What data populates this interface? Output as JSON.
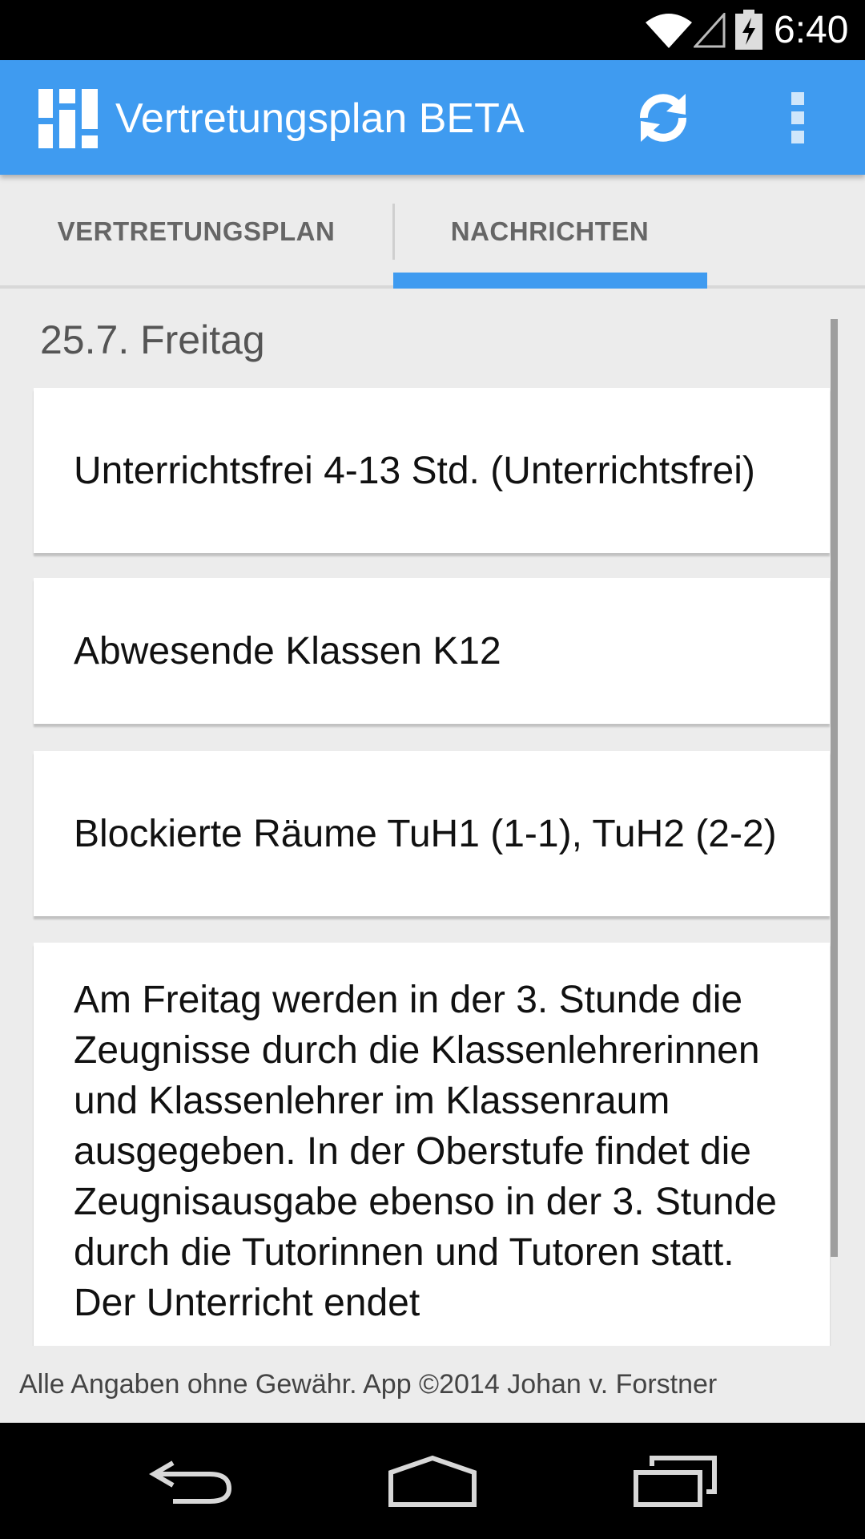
{
  "status_bar": {
    "time": "6:40",
    "icons": [
      "wifi-icon",
      "signal-icon",
      "battery-charging-icon"
    ]
  },
  "app_bar": {
    "title": "Vertretungsplan BETA",
    "icons": [
      "app-logo-icon",
      "refresh-icon",
      "overflow-menu-icon"
    ],
    "accent_color": "#3f9bf0"
  },
  "tabs": [
    {
      "label": "VERTRETUNGSPLAN",
      "selected": false
    },
    {
      "label": "NACHRICHTEN",
      "selected": true
    }
  ],
  "content": {
    "day_header": "25.7. Freitag",
    "cards": [
      {
        "text": "Unterrichtsfrei  4-13 Std. (Unterrichtsfrei)"
      },
      {
        "text": "Abwesende Klassen  K12"
      },
      {
        "text": "Blockierte Räume  TuH1 (1-1), TuH2 (2-2)"
      },
      {
        "text": "Am Freitag werden in der 3. Stunde die Zeugnisse durch die Klassenlehrerinnen und Klassenlehrer im Klassenraum ausgegeben. In der Oberstufe findet die Zeugnisausgabe ebenso in der 3. Stunde durch die Tutorinnen und Tutoren statt. Der Unterricht endet"
      }
    ]
  },
  "footer": {
    "text": "Alle Angaben ohne Gewähr. App ©2014 Johan v. Forstner"
  },
  "nav_bar": {
    "icons": [
      "back-icon",
      "home-icon",
      "recents-icon"
    ]
  }
}
